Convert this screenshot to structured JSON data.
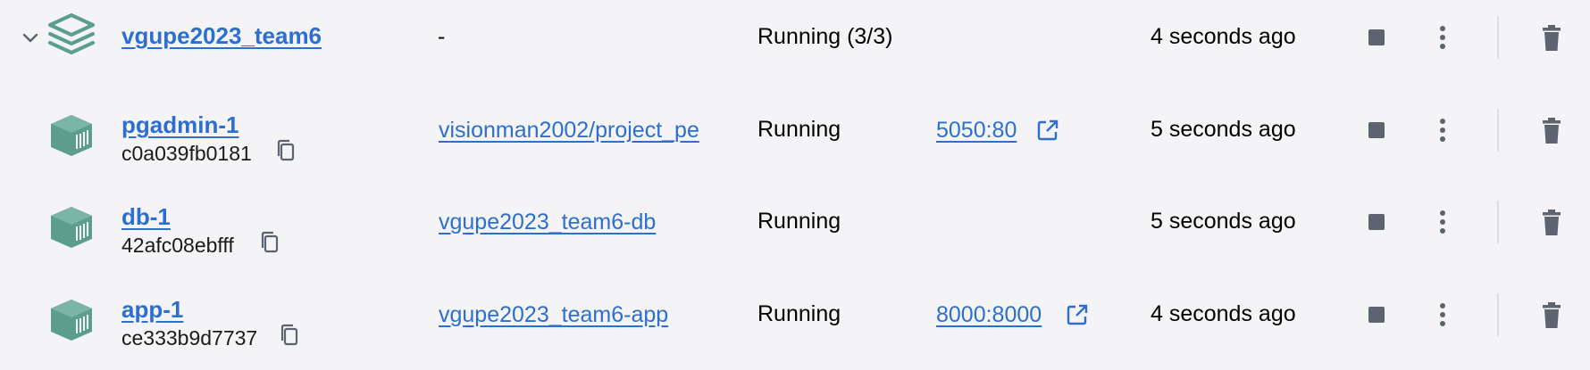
{
  "colors": {
    "link": "#2d6ed1",
    "icon_teal": "#5b9e8b",
    "action_icon": "#5c6470",
    "background": "#f4f4f6"
  },
  "group": {
    "name": "vgupe2023_team6",
    "image": "-",
    "status": "Running (3/3)",
    "last_started": "4 seconds ago",
    "icon": "stack-icon",
    "expand_icon": "chevron-down-icon"
  },
  "containers": [
    {
      "name": "pgadmin-1",
      "id": "c0a039fb0181",
      "image": "visionman2002/project_pe",
      "status": "Running",
      "port": "5050:80",
      "last_started": "5 seconds ago",
      "icon": "container-icon"
    },
    {
      "name": "db-1",
      "id": "42afc08ebfff",
      "image": "vgupe2023_team6-db",
      "status": "Running",
      "port": "",
      "last_started": "5 seconds ago",
      "icon": "container-icon"
    },
    {
      "name": "app-1",
      "id": "ce333b9d7737",
      "image": "vgupe2023_team6-app",
      "status": "Running",
      "port": "8000:8000",
      "last_started": "4 seconds ago",
      "icon": "container-icon"
    }
  ],
  "actions": {
    "stop_icon": "stop-icon",
    "more_icon": "more-vertical-icon",
    "delete_icon": "trash-icon",
    "copy_icon": "copy-icon",
    "external_icon": "external-link-icon"
  }
}
